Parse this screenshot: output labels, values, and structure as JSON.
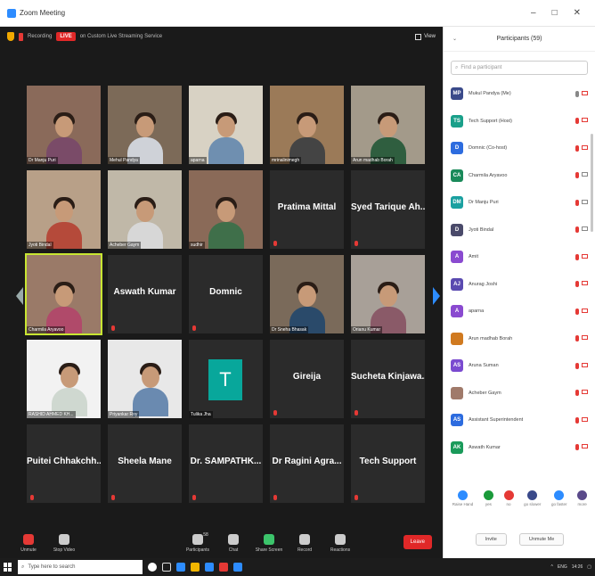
{
  "window": {
    "title": "Zoom Meeting",
    "controls": [
      "–",
      "□",
      "✕"
    ]
  },
  "meeting": {
    "recording_label": "Recording",
    "live_badge": "LIVE",
    "live_service": "on Custom Live Streaming Service",
    "view_label": "View"
  },
  "tiles": [
    {
      "kind": "video",
      "label": "Dr Manju Puri",
      "body": "#7a4b68",
      "bg": "#8a6a5a"
    },
    {
      "kind": "video",
      "label": "Mehul Pandya",
      "body": "#cfd2d8",
      "bg": "#7c6a58"
    },
    {
      "kind": "video",
      "label": "aparna",
      "body": "#6f8fb0",
      "bg": "#d8d2c4"
    },
    {
      "kind": "video",
      "label": "mrinalinimegh",
      "body": "#444",
      "bg": "#9b7a58"
    },
    {
      "kind": "video",
      "label": "Arun madhab Borah",
      "body": "#2f5e3f",
      "bg": "#a39a8a"
    },
    {
      "kind": "video",
      "label": "Jyoti Bindal",
      "body": "#b54a3a",
      "bg": "#b8a088"
    },
    {
      "kind": "video",
      "label": "Acheber Gaym",
      "body": "#d7d7d7",
      "bg": "#c0b8a8"
    },
    {
      "kind": "video",
      "label": "sudhir",
      "body": "#3f6f4a",
      "bg": "#8a6a58"
    },
    {
      "kind": "name",
      "big": "Pratima Mittal"
    },
    {
      "kind": "name",
      "big": "Syed Tarique Ah..."
    },
    {
      "kind": "video",
      "label": "Charmila Aryavoo",
      "body": "#b04a6a",
      "bg": "#9a7a68",
      "active": true
    },
    {
      "kind": "name",
      "big": "Aswath Kumar"
    },
    {
      "kind": "name",
      "big": "Domnic"
    },
    {
      "kind": "video",
      "label": "Dr Sneha Bhasak",
      "body": "#2a4a6a",
      "bg": "#7a6a5a"
    },
    {
      "kind": "video",
      "label": "Orianu Kumar",
      "body": "#8a5a68",
      "bg": "#a8a098"
    },
    {
      "kind": "photo",
      "label": "RASHID AHMED KH...",
      "body": "#cfd8d0",
      "bg": "#f2f2f2"
    },
    {
      "kind": "photo",
      "label": "Priyankar Roy",
      "body": "#6a8ab0",
      "bg": "#e8e8e8"
    },
    {
      "kind": "letter",
      "label": "Tulika Jha",
      "letter": "T"
    },
    {
      "kind": "name",
      "big": "Gireija"
    },
    {
      "kind": "name",
      "big": "Sucheta Kinjawa..."
    },
    {
      "kind": "name",
      "big": "Puitei Chhakchh..."
    },
    {
      "kind": "name",
      "big": "Sheela Mane"
    },
    {
      "kind": "name",
      "big": "Dr. SAMPATHK..."
    },
    {
      "kind": "name",
      "big": "Dr Ragini Agra..."
    },
    {
      "kind": "name",
      "big": "Tech Support"
    }
  ],
  "toolbar": [
    {
      "name": "unmute-button",
      "label": "Unmute",
      "cls": "red"
    },
    {
      "name": "stop-video-button",
      "label": "Stop Video",
      "cls": ""
    },
    {
      "name": "participants-button",
      "label": "Participants",
      "cls": ""
    },
    {
      "name": "chat-button",
      "label": "Chat",
      "cls": ""
    },
    {
      "name": "share-screen-button",
      "label": "Share Screen",
      "cls": "green"
    },
    {
      "name": "record-button",
      "label": "Record",
      "cls": ""
    },
    {
      "name": "reactions-button",
      "label": "Reactions",
      "cls": ""
    }
  ],
  "participants_count": "58",
  "leave_label": "Leave",
  "panel": {
    "title": "Participants (59)",
    "find_placeholder": "Find a participant"
  },
  "participants": [
    {
      "initials": "MP",
      "name": "Mukul Pandya (Me)",
      "color": "#3a4a8a",
      "mic": true,
      "vid": false
    },
    {
      "initials": "TS",
      "name": "Tech Support (Host)",
      "color": "#1aa08a",
      "mic": false,
      "vid": false
    },
    {
      "initials": "D",
      "name": "Domnic (Co-host)",
      "color": "#2d6cdf",
      "mic": false,
      "vid": false
    },
    {
      "initials": "CA",
      "name": "Charmila Aryavoo",
      "color": "#1a8a5a",
      "mic": false,
      "vid": true
    },
    {
      "initials": "DM",
      "name": "Dr Manju Puri",
      "color": "#1aa0a0",
      "mic": false,
      "vid": true
    },
    {
      "initials": "D",
      "name": "Jyoti Bindal",
      "color": "#4a4a6a",
      "mic": false,
      "vid": true
    },
    {
      "initials": "A",
      "name": "Amit",
      "color": "#8a4ad0",
      "mic": false,
      "vid": false
    },
    {
      "initials": "AJ",
      "name": "Anurag Joshi",
      "color": "#5a4ab0",
      "mic": false,
      "vid": false
    },
    {
      "initials": "A",
      "name": "aparna",
      "color": "#8a4ad0",
      "mic": false,
      "vid": false
    },
    {
      "initials": "",
      "name": "Arun madhab Borah",
      "color": "#d07a20",
      "mic": false,
      "vid": false
    },
    {
      "initials": "AS",
      "name": "Aruna Suman",
      "color": "#7a4ad0",
      "mic": false,
      "vid": false
    },
    {
      "initials": "",
      "name": "Acheber Gaym",
      "color": "#a07a6a",
      "mic": false,
      "vid": false
    },
    {
      "initials": "AS",
      "name": "Assistant Superintendent",
      "color": "#2d6cdf",
      "mic": false,
      "vid": false
    },
    {
      "initials": "AK",
      "name": "Aswath Kumar",
      "color": "#1a9a5a",
      "mic": false,
      "vid": false
    }
  ],
  "reactions": [
    {
      "label": "Raise Hand",
      "color": "#2d8cff"
    },
    {
      "label": "yes",
      "color": "#1a9a3a"
    },
    {
      "label": "no",
      "color": "#e53935"
    },
    {
      "label": "go slower",
      "color": "#3a4a8a"
    },
    {
      "label": "go faster",
      "color": "#2d8cff"
    },
    {
      "label": "more",
      "color": "#5a4a8a"
    }
  ],
  "panel_buttons": {
    "invite": "Invite",
    "unmute_me": "Unmute Me"
  },
  "taskbar": {
    "search_placeholder": "Type here to search",
    "time": "14:26",
    "lang": "ENG"
  }
}
